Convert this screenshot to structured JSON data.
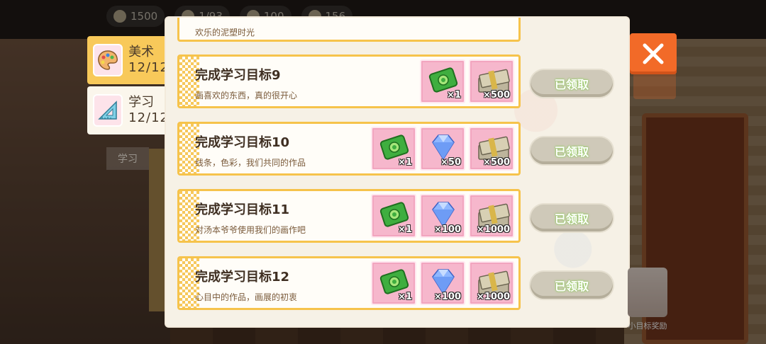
{
  "currency": [
    {
      "icon": "graduation-cap-icon",
      "value": "1500"
    },
    {
      "icon": "energy-icon",
      "value": "1/93"
    },
    {
      "icon": "gift-icon",
      "value": "100"
    },
    {
      "icon": "gear-icon",
      "value": "156"
    }
  ],
  "tabs": [
    {
      "name": "美术",
      "count": "12/12",
      "icon": "palette-icon",
      "active": true
    },
    {
      "name": "学习",
      "count": "12/12",
      "icon": "ruler-icon",
      "active": false
    }
  ],
  "background_caption": "学习",
  "partial_row": {
    "desc": "欢乐的泥塑时光"
  },
  "goals": [
    {
      "title": "完成学习目标9",
      "desc": "画喜欢的东西，真的很开心",
      "rewards": [
        {
          "type": "green-ticket-icon",
          "qty": "×1"
        },
        {
          "type": "cash-stack-icon",
          "qty": "×500"
        }
      ],
      "button": "已领取"
    },
    {
      "title": "完成学习目标10",
      "desc": "线条，色彩，我们共同的作品",
      "rewards": [
        {
          "type": "green-ticket-icon",
          "qty": "×1"
        },
        {
          "type": "diamond-icon",
          "qty": "×50"
        },
        {
          "type": "cash-stack-icon",
          "qty": "×500"
        }
      ],
      "button": "已领取"
    },
    {
      "title": "完成学习目标11",
      "desc": "对汤本爷爷使用我们的画作吧",
      "rewards": [
        {
          "type": "green-ticket-icon",
          "qty": "×1"
        },
        {
          "type": "diamond-icon",
          "qty": "×100"
        },
        {
          "type": "cash-stack-icon",
          "qty": "×1000"
        }
      ],
      "button": "已领取"
    },
    {
      "title": "完成学习目标12",
      "desc": "心目中的作品，画展的初衷",
      "rewards": [
        {
          "type": "green-ticket-icon",
          "qty": "×1"
        },
        {
          "type": "diamond-icon",
          "qty": "×100"
        },
        {
          "type": "cash-stack-icon",
          "qty": "×1000"
        }
      ],
      "button": "已领取"
    }
  ],
  "goal_reward_label": "小目标奖励",
  "colors": {
    "accent_yellow": "#f6c34b",
    "reward_pink": "#f6b7cc",
    "close_orange": "#f26a28",
    "claimed_gray": "#cfc9b9"
  }
}
